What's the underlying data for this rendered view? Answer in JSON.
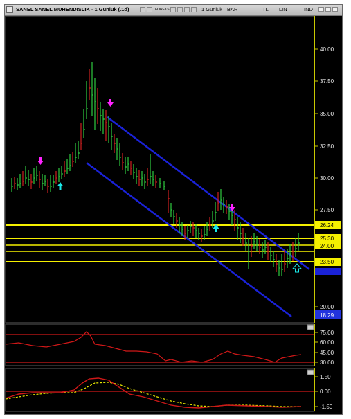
{
  "window": {
    "title": "SANEL SANEL MUHENDISLIK - 1 Günlük (.1d)",
    "period": "1 Günlük",
    "menu": [
      "BAR",
      "TL",
      "LIN",
      "IND"
    ],
    "logo_text": "FOREKS"
  },
  "price_axis": {
    "ticks": [
      "40.00",
      "37.50",
      "35.00",
      "32.50",
      "30.00",
      "27.50",
      "20.00"
    ],
    "tags": [
      {
        "text": "26.24",
        "color": "#f5f000"
      },
      {
        "text": "25.30",
        "color": "#f5f000"
      },
      {
        "text": "24.00",
        "color": "#f5f000"
      },
      {
        "text": "23.50",
        "color": "#f5f000"
      },
      {
        "text": "18.29",
        "color": "#2233dd"
      }
    ]
  },
  "osc1_axis": {
    "ticks": [
      "75.00",
      "60.00",
      "45.00",
      "30.00"
    ]
  },
  "osc2_axis": {
    "ticks": [
      "1.50",
      "0.00",
      "-1.50"
    ]
  },
  "colors": {
    "up_candle": "#2ecc40",
    "down_candle": "#d02020",
    "channel": "#1a22d8",
    "support": "#f5f000",
    "buy_arrow": "#19e8e8",
    "sell_arrow": "#ff22ff",
    "osc_line": "#d01818",
    "signal_line": "#e6e600"
  }
}
